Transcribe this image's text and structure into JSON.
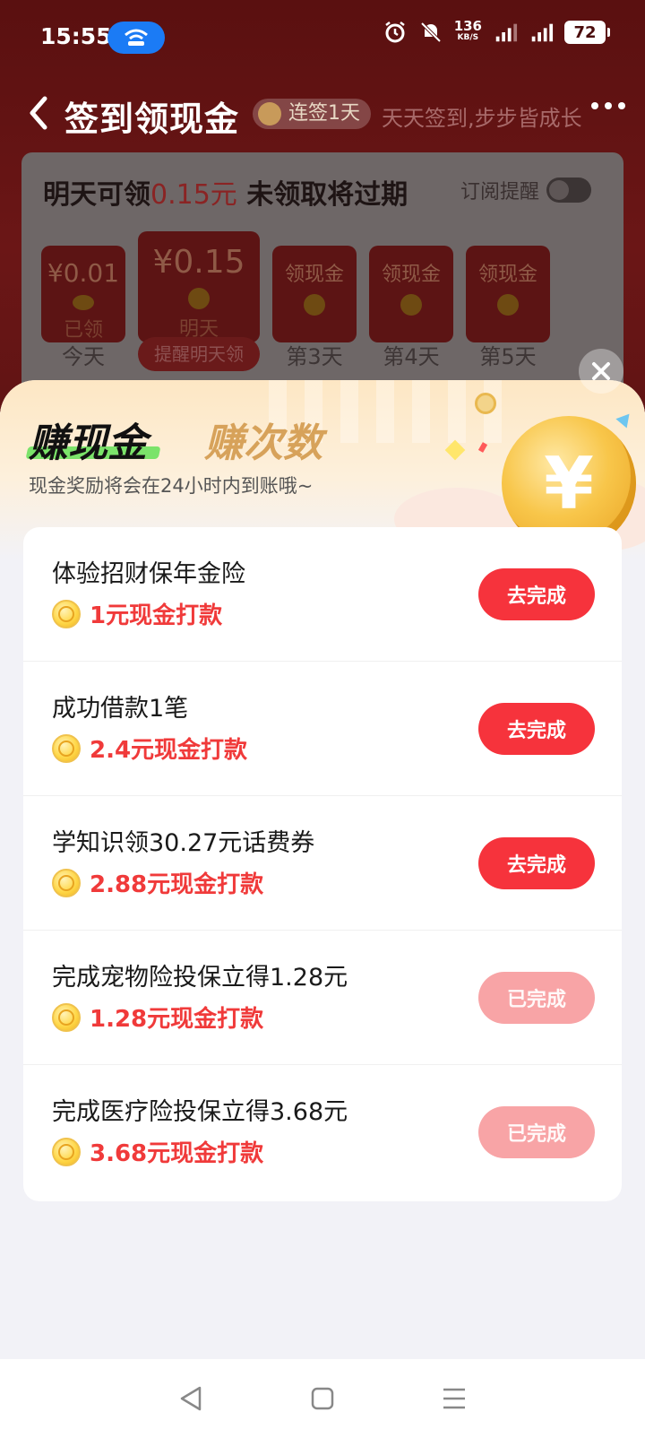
{
  "status": {
    "time": "15:55",
    "net_speed_value": "136",
    "net_speed_unit": "KB/S",
    "battery": "72"
  },
  "header": {
    "title": "签到领现金",
    "streak": "连签1天",
    "slogan": "天天签到,步步皆成长"
  },
  "signin": {
    "prefix": "明天可领",
    "amount": "0.15元",
    "suffix": " 未领取将过期",
    "subscribe_label": "订阅提醒",
    "envelopes": [
      {
        "value": "¥0.01",
        "sub": "已领",
        "day": "今天"
      },
      {
        "value": "¥0.15",
        "sub": "明天",
        "day": "提醒明天领"
      },
      {
        "value": "领现金",
        "sub": "",
        "day": "第3天"
      },
      {
        "value": "领现金",
        "sub": "",
        "day": "第4天"
      },
      {
        "value": "领现金",
        "sub": "",
        "day": "第5天"
      }
    ]
  },
  "sheet": {
    "tab_cash": "赚现金",
    "tab_count": "赚次数",
    "note": "现金奖励将会在24小时内到账哦~",
    "coin_symbol": "¥"
  },
  "tasks": [
    {
      "title": "体验招财保年金险",
      "reward": "1元现金打款",
      "button": "去完成",
      "done": false
    },
    {
      "title": "成功借款1笔",
      "reward": "2.4元现金打款",
      "button": "去完成",
      "done": false
    },
    {
      "title": "学知识领30.27元话费券",
      "reward": "2.88元现金打款",
      "button": "去完成",
      "done": false
    },
    {
      "title": "完成宠物险投保立得1.28元",
      "reward": "1.28元现金打款",
      "button": "已完成",
      "done": true
    },
    {
      "title": "完成医疗险投保立得3.68元",
      "reward": "3.68元现金打款",
      "button": "已完成",
      "done": true
    }
  ],
  "colors": {
    "accent_red": "#f6333c",
    "done_pink": "#f8a4a6",
    "reward_red": "#f03a3a",
    "green_underline": "#7be36a",
    "gold": "#d7a25a"
  }
}
